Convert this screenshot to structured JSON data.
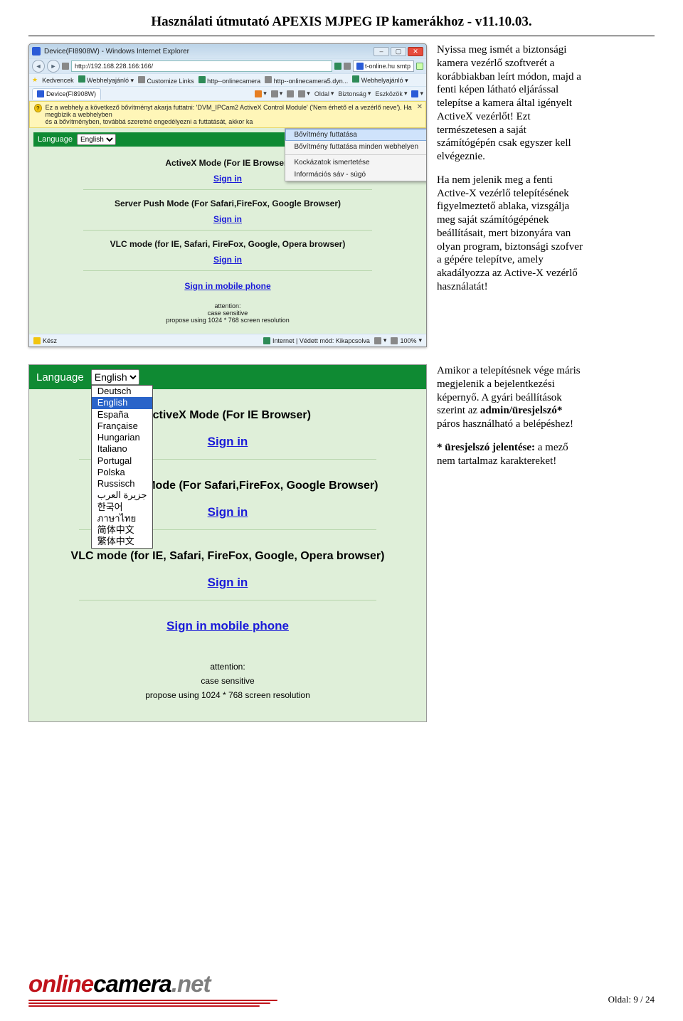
{
  "header": "Használati útmutató APEXIS MJPEG IP kamerákhoz - v11.10.03.",
  "ie": {
    "title": "Device(FI8908W) - Windows Internet Explorer",
    "url": "http://192.168.228.166:166/",
    "search_hint": "t-online.hu smtp",
    "fav_label": "Kedvencek",
    "fav_items": [
      "Webhelyajánló",
      "Customize Links",
      "http--onlinecamera",
      "http--onlinecamera5.dyn...",
      "Webhelyajánló"
    ],
    "tab": "Device(FI8908W)",
    "tools": {
      "page": "Oldal",
      "safety": "Biztonság",
      "tools": "Eszközök"
    },
    "infobar_line1": "Ez a webhely a következő bővítményt akarja futtatni: 'DVM_IPCam2 ActiveX Control Module' ('Nem érhető el a vezérlő neve'). Ha megbízik a webhelyben",
    "infobar_line2": "és a bővítményben, továbbá szeretné engedélyezni a futtatását, akkor ka",
    "ctx": {
      "i1": "Bővítmény futtatása",
      "i2": "Bővítmény futtatása minden webhelyen",
      "i3": "Kockázatok ismertetése",
      "i4": "Információs sáv - súgó"
    },
    "status_ready": "Kész",
    "status_zone": "Internet | Védett mód: Kikapcsolva",
    "status_zoom": "100%"
  },
  "cam": {
    "lang_label": "Language",
    "lang_value": "English",
    "s1": "ActiveX Mode (For IE Browser)",
    "s2": "Server Push Mode (For Safari,FireFox, Google Browser)",
    "s3": "VLC mode (for IE, Safari, FireFox, Google, Opera browser)",
    "signin": "Sign in",
    "signin_mobile": "Sign in mobile phone",
    "attn": "attention:",
    "sub1": "case sensitive",
    "sub2": "propose using 1024 * 768 screen resolution"
  },
  "para1": {
    "p1": "Nyissa meg ismét a biztonsági kamera vezérlő szoftverét a korábbiakban leírt módon, majd a fenti képen látható eljárással telepítse a kamera által igényelt ActiveX vezérlőt! Ezt természetesen a saját számítógépén csak egyszer kell elvégeznie.",
    "p2": "Ha nem jelenik meg a fenti Active-X vezérlő telepítésének figyelmeztető ablaka, vizsgálja meg saját számítógépének beállításait, mert bizonyára van olyan program, biztonsági szofver a gépére telepítve, amely akadályozza az Active-X vezérlő használatát!"
  },
  "shot2": {
    "langs": [
      "Deutsch",
      "English",
      "España",
      "Française",
      "Hungarian",
      "Italiano",
      "Portugal",
      "Polska",
      "Russisch",
      "جزيرة العرب",
      "한국어",
      "ภาษาไทย",
      "简体中文",
      "繁体中文"
    ],
    "s2_short": "n Mode (For Safari,FireFox, Google Browser)"
  },
  "para2": {
    "p1a": "Amikor a telepítésnek vége máris megjelenik a bejelentkezési képernyő. A gyári beállítások szerint az ",
    "p1b": "admin/üresjelszó*",
    "p1c": " páros használható a belépéshez!",
    "p2a": "* üresjelszó jelentése:",
    "p2b": " a mező nem tartalmaz karaktereket!"
  },
  "footer": {
    "logo1": "online",
    "logo2": "camera",
    "logo3": ".net",
    "page": "Oldal: 9 / 24"
  }
}
